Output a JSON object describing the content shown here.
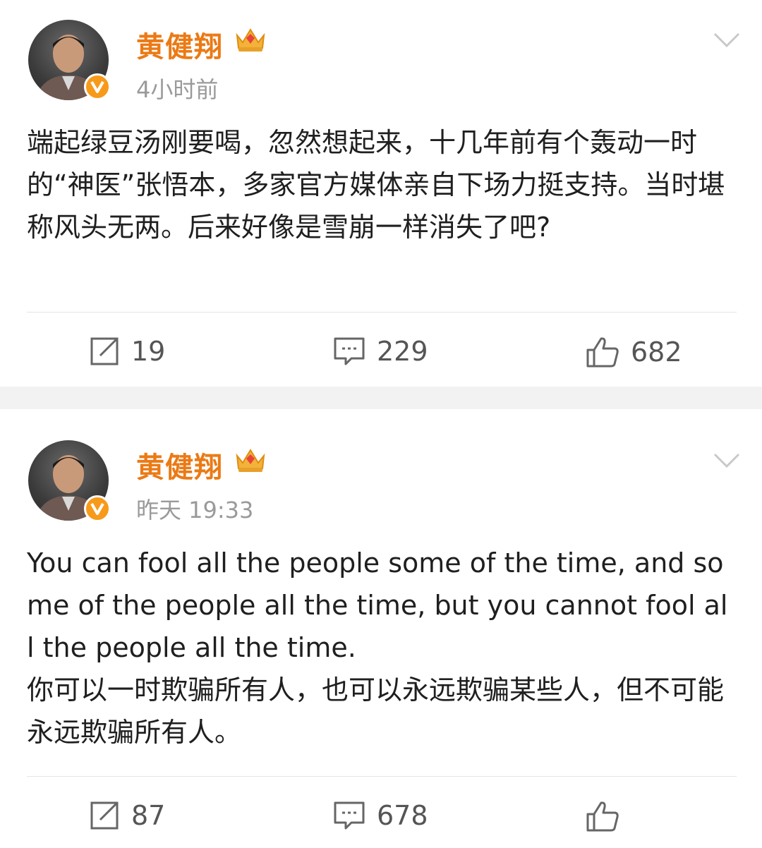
{
  "posts": [
    {
      "author": "黄健翔",
      "time": "4小时前",
      "content": "端起绿豆汤刚要喝，忽然想起来，十几年前有个轰动一时的“神医”张悟本，多家官方媒体亲自下场力挺支持。当时堪称风头无两。后来好像是雪崩一样消失了吧?",
      "reposts": "19",
      "comments": "229",
      "likes": "682"
    },
    {
      "author": "黄健翔",
      "time": "昨天 19:33",
      "content": "You can fool all the people some of the time, and some of the people all the time, but you cannot fool all the people all the time.\n你可以一时欺骗所有人，也可以永远欺骗某些人，但不可能永远欺骗所有人。",
      "reposts": "87",
      "comments": "678"
    }
  ],
  "icons": {
    "repost": "repost-icon",
    "comment": "comment-icon",
    "like": "like-icon",
    "more": "chevron-down-icon",
    "verified": "verified-v-icon",
    "vip": "crown-icon"
  },
  "colors": {
    "author": "#eb7a15",
    "verified_badge": "#f79a1a",
    "meta": "#9a9a9a",
    "separator": "#f2f2f2"
  }
}
